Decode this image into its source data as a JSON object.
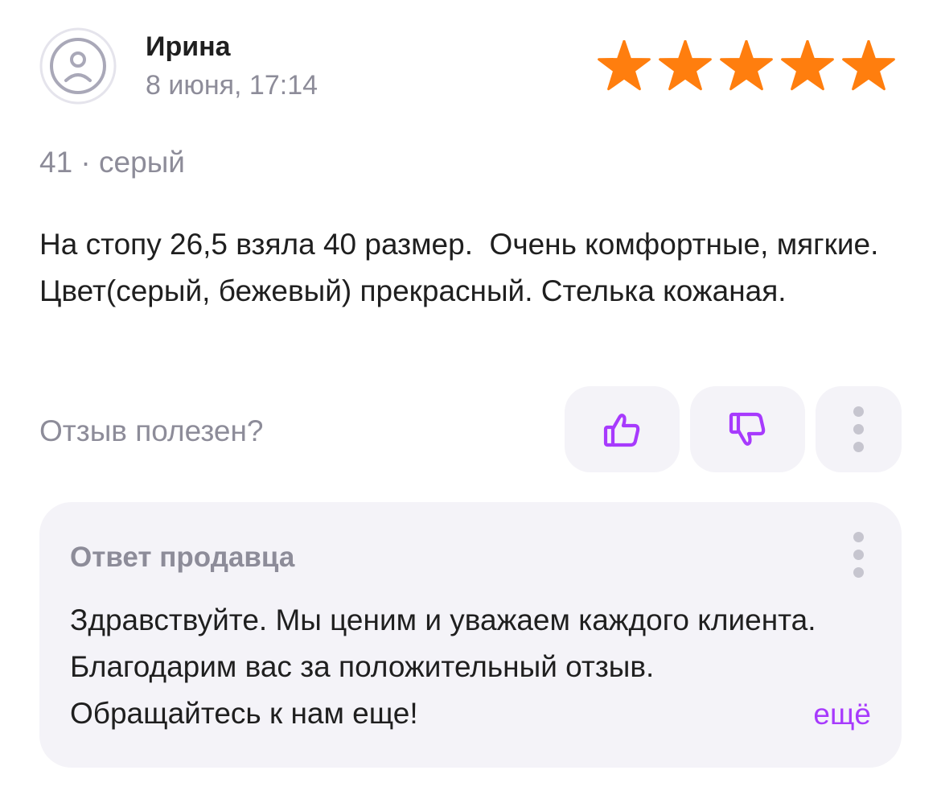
{
  "review": {
    "author_name": "Ирина",
    "date": "8 июня, 17:14",
    "rating": 5,
    "rating_max": 5,
    "variant": "41 · серый",
    "text": "На стопу 26,5 взяла 40 размер.  Очень комфортные, мягкие. Цвет(серый, бежевый) прекрасный. Стелька кожаная."
  },
  "helpful": {
    "label": "Отзыв полезен?"
  },
  "seller_reply": {
    "title": "Ответ продавца",
    "text": "Здравствуйте. Мы ценим и уважаем каждого клиента. Благодарим вас за положительный отзыв. Обращайтесь к нам еще!",
    "expand_label": "ещё"
  },
  "colors": {
    "star": "#ff7e0e",
    "accent": "#a73afd",
    "muted_text": "#8d8c99",
    "button_bg": "#f4f3f8"
  },
  "icons": {
    "avatar": "user-circle-icon",
    "like": "thumbs-up-icon",
    "dislike": "thumbs-down-icon",
    "more": "more-vertical-icon"
  }
}
